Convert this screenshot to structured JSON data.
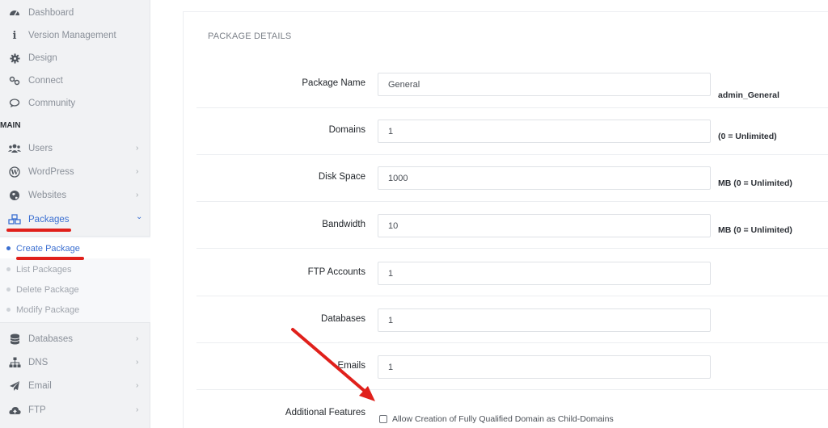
{
  "sidebar": {
    "top_items": [
      {
        "label": "Dashboard",
        "icon": "dashboard-icon"
      },
      {
        "label": "Version Management",
        "icon": "info-icon"
      },
      {
        "label": "Design",
        "icon": "gear-icon"
      },
      {
        "label": "Connect",
        "icon": "link-icon"
      },
      {
        "label": "Community",
        "icon": "chat-icon"
      }
    ],
    "section_label": "MAIN",
    "main_items": [
      {
        "label": "Users",
        "icon": "users-icon",
        "chevron": "›"
      },
      {
        "label": "WordPress",
        "icon": "wordpress-icon",
        "chevron": "›"
      },
      {
        "label": "Websites",
        "icon": "globe-icon",
        "chevron": "›"
      },
      {
        "label": "Packages",
        "icon": "cubes-icon",
        "chevron": "⌄"
      }
    ],
    "package_submenu": [
      {
        "label": "Create Package"
      },
      {
        "label": "List Packages"
      },
      {
        "label": "Delete Package"
      },
      {
        "label": "Modify Package"
      }
    ],
    "bottom_items": [
      {
        "label": "Databases",
        "icon": "database-icon",
        "chevron": "›"
      },
      {
        "label": "DNS",
        "icon": "sitemap-icon",
        "chevron": "›"
      },
      {
        "label": "Email",
        "icon": "paper-plane-icon",
        "chevron": "›"
      },
      {
        "label": "FTP",
        "icon": "cloud-upload-icon",
        "chevron": "›"
      }
    ]
  },
  "panel": {
    "title": "PACKAGE DETAILS",
    "fields": [
      {
        "label": "Package Name",
        "value": "General",
        "note": "admin_General"
      },
      {
        "label": "Domains",
        "value": "1",
        "note": "(0 = Unlimited)"
      },
      {
        "label": "Disk Space",
        "value": "1000",
        "note": "MB (0 = Unlimited)"
      },
      {
        "label": "Bandwidth",
        "value": "10",
        "note": "MB (0 = Unlimited)"
      },
      {
        "label": "FTP Accounts",
        "value": "1",
        "note": ""
      },
      {
        "label": "Databases",
        "value": "1",
        "note": ""
      },
      {
        "label": "Emails",
        "value": "1",
        "note": ""
      }
    ],
    "additional": {
      "label": "Additional Features",
      "option_label": "Allow Creation of Fully Qualified Domain as Child-Domains",
      "checked": false
    }
  },
  "colors": {
    "accent": "#3b6fd1",
    "annotation_red": "#e0201b"
  }
}
